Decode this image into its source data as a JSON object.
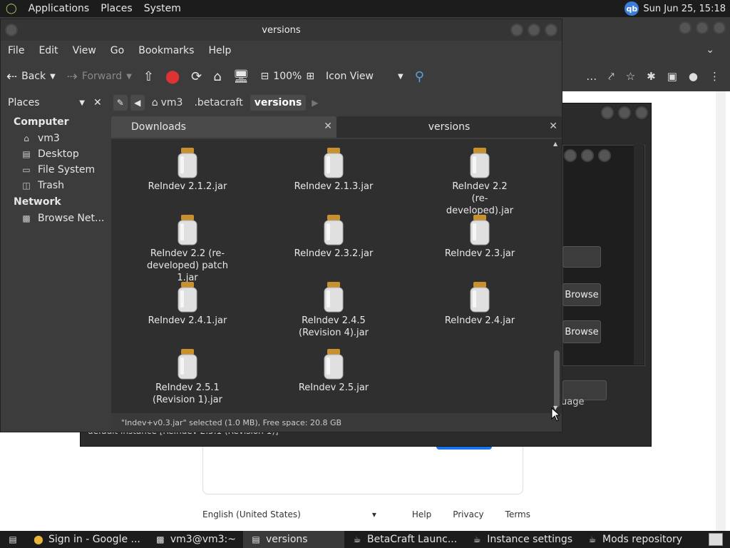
{
  "top_panel": {
    "menus": [
      "Applications",
      "Places",
      "System"
    ],
    "user_badge": "qb",
    "clock": "Sun Jun 25, 15:18"
  },
  "browser": {
    "footer_language": "English (United States)",
    "footer_links": [
      "Help",
      "Privacy",
      "Terms"
    ]
  },
  "betacraft": {
    "browse_label_1": "Browse",
    "browse_label_2": "Browse",
    "usage_fragment": "uage",
    "status": "default instance [ReIndev 2.5.1 (Revision 1)]"
  },
  "nautilus": {
    "title": "versions",
    "menu": [
      "File",
      "Edit",
      "View",
      "Go",
      "Bookmarks",
      "Help"
    ],
    "toolbar": {
      "back": "Back",
      "forward": "Forward",
      "zoom": "100%",
      "view_mode": "Icon View"
    },
    "places_combo": "Places",
    "breadcrumbs": [
      "vm3",
      ".betacraft",
      "versions"
    ],
    "sidebar": {
      "computer_header": "Computer",
      "computer_items": [
        "vm3",
        "Desktop",
        "File System",
        "Trash"
      ],
      "network_header": "Network",
      "network_items": [
        "Browse Net..."
      ]
    },
    "tabs": [
      "Downloads",
      "versions"
    ],
    "files": [
      "ReIndev 2.1.2.jar",
      "ReIndev 2.1.3.jar",
      "ReIndev 2.2 (re-developed).jar",
      "ReIndev 2.2 (re-developed) patch 1.jar",
      "ReIndev 2.3.2.jar",
      "ReIndev 2.3.jar",
      "ReIndev 2.4.1.jar",
      "ReIndev 2.4.5 (Revision 4).jar",
      "ReIndev 2.4.jar",
      "ReIndev 2.5.1 (Revision 1).jar",
      "ReIndev 2.5.jar"
    ],
    "status": "\"Indev+v0.3.jar\" selected (1.0 MB), Free space: 20.8 GB"
  },
  "taskbar": {
    "tasks": [
      "Sign in - Google ...",
      "vm3@vm3:~",
      "versions",
      "BetaCraft Launc...",
      "Instance settings",
      "Mods repository"
    ]
  }
}
